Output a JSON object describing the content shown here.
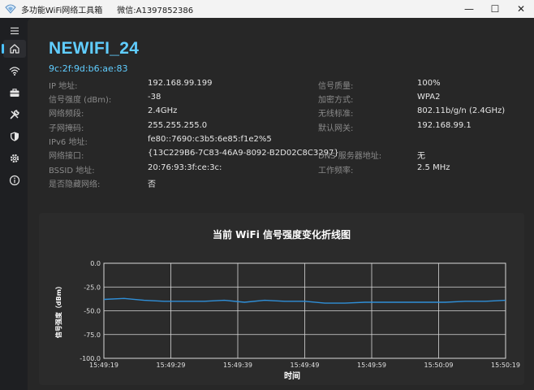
{
  "window": {
    "title": "多功能WiFi网络工具箱",
    "contact": "微信:A1397852386",
    "minimize_glyph": "—",
    "maximize_glyph": "☐",
    "close_glyph": "✕"
  },
  "sidebar": {
    "items": [
      {
        "icon": "hamburger-menu-icon",
        "active": false
      },
      {
        "icon": "home-icon",
        "active": true
      },
      {
        "icon": "wifi-icon",
        "active": false
      },
      {
        "icon": "toolbox-icon",
        "active": false
      },
      {
        "icon": "tools-icon",
        "active": false
      },
      {
        "icon": "shield-icon",
        "active": false
      },
      {
        "icon": "gear-icon",
        "active": false
      },
      {
        "icon": "info-icon",
        "active": false
      }
    ]
  },
  "network": {
    "ssid": "NEWIFI_24",
    "mac": "9c:2f:9d:b6:ae:83",
    "left_fields": [
      {
        "label": "IP 地址:",
        "value": "192.168.99.199"
      },
      {
        "label": "信号强度 (dBm):",
        "value": "-38"
      },
      {
        "label": "网络频段:",
        "value": "2.4GHz"
      },
      {
        "label": "子网掩码:",
        "value": "255.255.255.0"
      },
      {
        "label": "IPv6 地址:",
        "value": "fe80::7690:c3b5:6e85:f1e2%5"
      },
      {
        "label": "网络接口:",
        "value": "{13C229B6-7C83-46A9-8092-B2D02C8C3297}"
      },
      {
        "label": "BSSID 地址:",
        "value": "20:76:93:3f:ce:3c:"
      },
      {
        "label": "是否隐藏网络:",
        "value": "否"
      }
    ],
    "right_fields": [
      {
        "label": "信号质量:",
        "value": "100%"
      },
      {
        "label": "加密方式:",
        "value": "WPA2"
      },
      {
        "label": "无线标准:",
        "value": "802.11b/g/n (2.4GHz)"
      },
      {
        "label": "默认网关:",
        "value": "192.168.99.1"
      },
      {
        "label": "",
        "value": ""
      },
      {
        "label": "DNS 服务器地址:",
        "value": "无"
      },
      {
        "label": "工作频率:",
        "value": "2.5 MHz"
      }
    ]
  },
  "colors": {
    "accent": "#60cdff",
    "line": "#2f8fd8",
    "grid": "#d9d9d9",
    "plot_bg": "#2b2b2b"
  },
  "chart_data": {
    "type": "line",
    "title": "当前 WiFi 信号强度变化折线图",
    "xlabel": "时间",
    "ylabel": "信号强度（dBm）",
    "x_ticks": [
      "15:49:19",
      "15:49:29",
      "15:49:39",
      "15:49:49",
      "15:49:59",
      "15:50:09",
      "15:50:19"
    ],
    "y_ticks": [
      "0.0",
      "-25.0",
      "-50.0",
      "-75.0",
      "-100.0"
    ],
    "ylim": [
      -100,
      0
    ],
    "xlim": [
      0,
      60
    ],
    "grid": true,
    "series": [
      {
        "name": "",
        "x": [
          0,
          3,
          6,
          9,
          12,
          15,
          18,
          21,
          24,
          27,
          30,
          33,
          36,
          39,
          42,
          45,
          48,
          51,
          54,
          57,
          60
        ],
        "values": [
          -38,
          -37,
          -39,
          -40,
          -40,
          -40,
          -39,
          -41,
          -39,
          -40,
          -40,
          -42,
          -42,
          -41,
          -41,
          -41,
          -41,
          -41,
          -40,
          -40,
          -39
        ]
      }
    ]
  }
}
